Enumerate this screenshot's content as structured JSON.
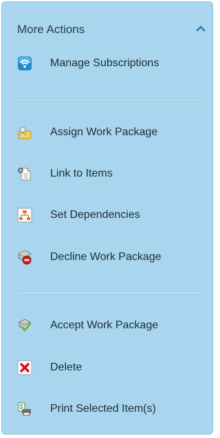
{
  "panel": {
    "title": "More Actions",
    "items_top": [
      {
        "label": "Manage Subscriptions",
        "icon": "subscription-icon"
      }
    ],
    "items_mid": [
      {
        "label": "Assign Work Package",
        "icon": "assign-icon"
      },
      {
        "label": "Link to Items",
        "icon": "link-document-icon"
      },
      {
        "label": "Set Dependencies",
        "icon": "dependencies-icon"
      },
      {
        "label": "Decline Work Package",
        "icon": "decline-icon"
      }
    ],
    "items_bottom": [
      {
        "label": "Accept Work Package",
        "icon": "accept-icon"
      },
      {
        "label": "Delete",
        "icon": "delete-icon"
      },
      {
        "label": "Print Selected Item(s)",
        "icon": "print-icon"
      }
    ]
  }
}
